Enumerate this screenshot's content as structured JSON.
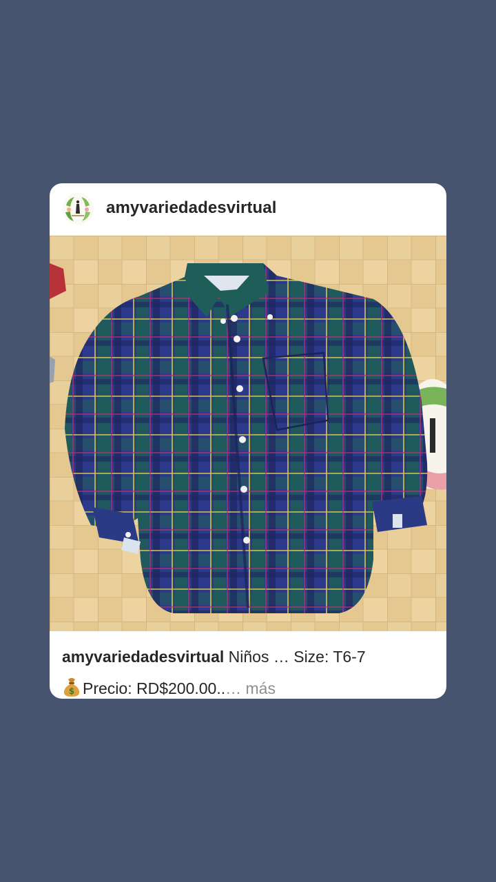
{
  "post": {
    "username": "amyvariedadesvirtual",
    "caption_username": "amyvariedadesvirtual",
    "caption_line1_text": "Niños … Size: T6-7",
    "caption_line2_text": "Precio: RD$200.00..",
    "more_label": "… más"
  },
  "icons": {
    "avatar": "boutique-logo-avatar",
    "money": "money-bag-emoji"
  },
  "colors": {
    "background": "#465470",
    "card": "#ffffff",
    "text": "#262626",
    "muted": "#8e8e8e"
  }
}
